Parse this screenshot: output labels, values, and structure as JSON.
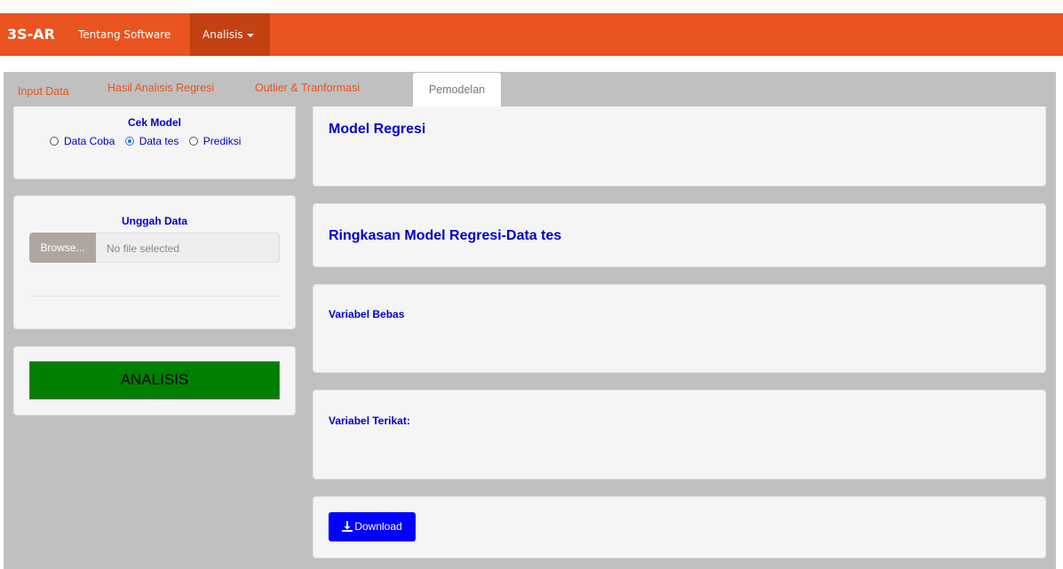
{
  "navbar": {
    "brand": "3S-AR",
    "about_label": "Tentang Software",
    "analisis_label": "Analisis"
  },
  "tabs": {
    "input_data": "Input Data",
    "hasil": "Hasil Analisis Regresi",
    "outlier": "Outlier & Tranformasi",
    "pemodelan": "Pemodelan"
  },
  "sidebar": {
    "cek_model_title": "Cek Model",
    "radios": [
      "Data Coba",
      "Data tes",
      "Prediksi"
    ],
    "selected_radio": "Data tes",
    "upload_title": "Unggah Data",
    "browse_label": "Browse...",
    "file_placeholder": "No file selected",
    "analisis_label": "ANALISIS"
  },
  "main": {
    "model_title": "Model Regresi",
    "ringkasan_title": "Ringkasan Model Regresi-Data tes",
    "bebas_label": "Variabel Bebas",
    "terikat_label": "Variabel Terikat:",
    "download_label": "Download"
  },
  "colors": {
    "navbar": "#e95420",
    "active_nav": "#c34113",
    "heading_blue": "#0000cc",
    "analisis_green": "#008000",
    "download_blue": "#0000ff"
  }
}
